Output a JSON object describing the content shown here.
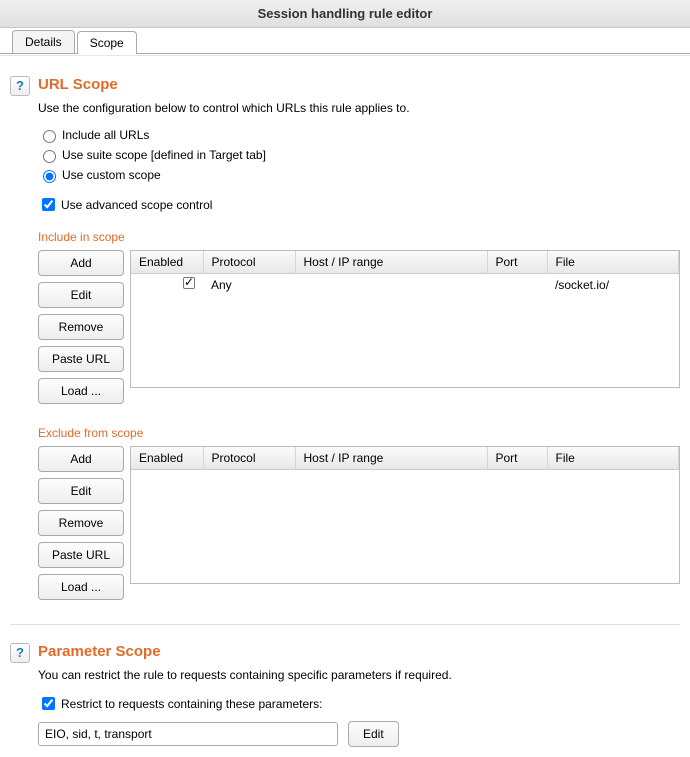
{
  "window": {
    "title": "Session handling rule editor"
  },
  "tabs": {
    "details": "Details",
    "scope": "Scope",
    "active": "scope"
  },
  "urlScope": {
    "title": "URL Scope",
    "desc": "Use the configuration below to control which URLs this rule applies to.",
    "options": {
      "includeAll": "Include all URLs",
      "suiteScope": "Use suite scope [defined in Target tab]",
      "custom": "Use custom scope",
      "selected": "custom"
    },
    "advanced": {
      "label": "Use advanced scope control",
      "checked": true
    }
  },
  "buttons": {
    "add": "Add",
    "edit": "Edit",
    "remove": "Remove",
    "pasteUrl": "Paste URL",
    "load": "Load ..."
  },
  "columns": {
    "enabled": "Enabled",
    "protocol": "Protocol",
    "host": "Host / IP range",
    "port": "Port",
    "file": "File"
  },
  "include": {
    "heading": "Include in scope",
    "rows": [
      {
        "enabled": true,
        "protocol": "Any",
        "host": "",
        "port": "",
        "file": "/socket.io/"
      }
    ]
  },
  "exclude": {
    "heading": "Exclude from scope",
    "rows": []
  },
  "paramScope": {
    "title": "Parameter Scope",
    "desc": "You can restrict the rule to requests containing specific parameters if required.",
    "restrict": {
      "label": "Restrict to requests containing these parameters:",
      "checked": true
    },
    "value": "EIO, sid, t, transport",
    "editLabel": "Edit"
  },
  "helpGlyph": "?"
}
